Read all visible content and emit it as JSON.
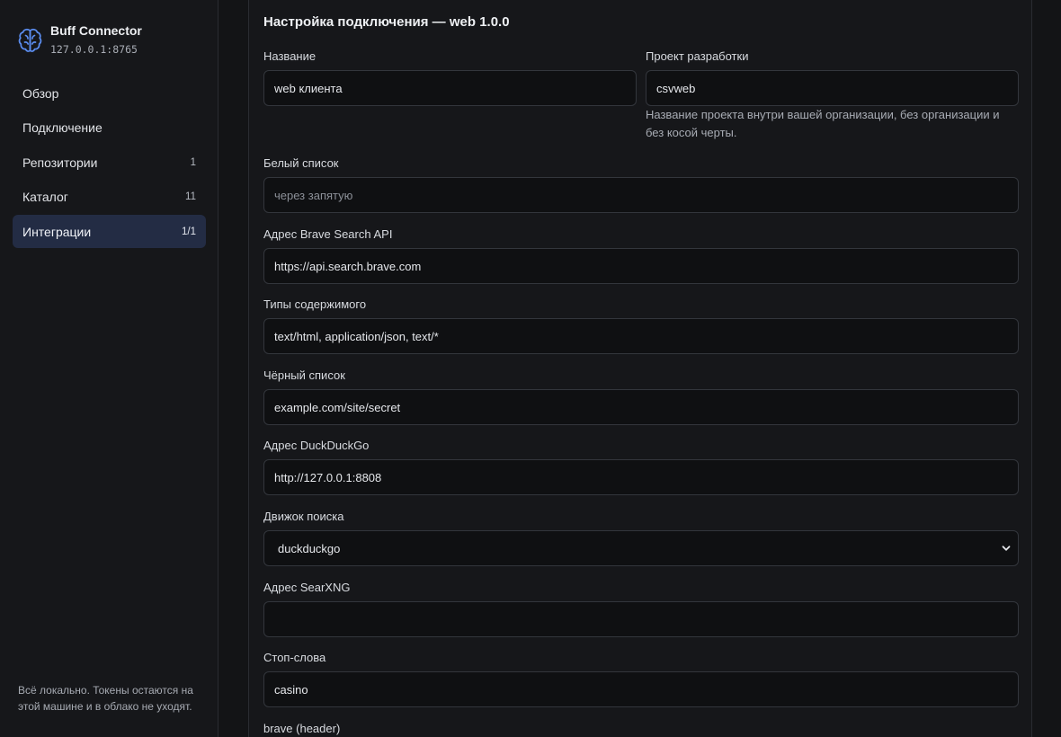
{
  "brand": {
    "name": "Buff Connector",
    "address": "127.0.0.1:8765"
  },
  "nav": {
    "items": [
      {
        "label": "Обзор",
        "count": ""
      },
      {
        "label": "Подключение",
        "count": ""
      },
      {
        "label": "Репозитории",
        "count": "1"
      },
      {
        "label": "Каталог",
        "count": "11"
      },
      {
        "label": "Интеграции",
        "count": "1/1"
      }
    ]
  },
  "sidebar_footer": "Всё локально. Токены остаются на этой машине и в облако не уходят.",
  "form": {
    "title": "Настройка подключения — web 1.0.0",
    "name": {
      "label": "Название",
      "value": "web клиента"
    },
    "project": {
      "label": "Проект разработки",
      "value": "csvweb",
      "hint": "Название проекта внутри вашей организации, без организации и без косой черты."
    },
    "whitelist": {
      "label": "Белый список",
      "value": "",
      "placeholder": "через запятую"
    },
    "brave_url": {
      "label": "Адрес Brave Search API",
      "value": "https://api.search.brave.com"
    },
    "content_types": {
      "label": "Типы содержимого",
      "value": "text/html, application/json, text/*"
    },
    "blacklist": {
      "label": "Чёрный список",
      "value": "example.com/site/secret"
    },
    "ddg_url": {
      "label": "Адрес DuckDuckGo",
      "value": "http://127.0.0.1:8808"
    },
    "engine": {
      "label": "Движок поиска",
      "value": "duckduckgo"
    },
    "searxng_url": {
      "label": "Адрес SearXNG",
      "value": ""
    },
    "stopwords": {
      "label": "Стоп-слова",
      "value": "casino"
    },
    "brave_header": {
      "label": "brave (header)"
    }
  },
  "colors": {
    "accent": "#5b8df0",
    "active_nav_bg": "#232c44",
    "background": "#131416"
  }
}
